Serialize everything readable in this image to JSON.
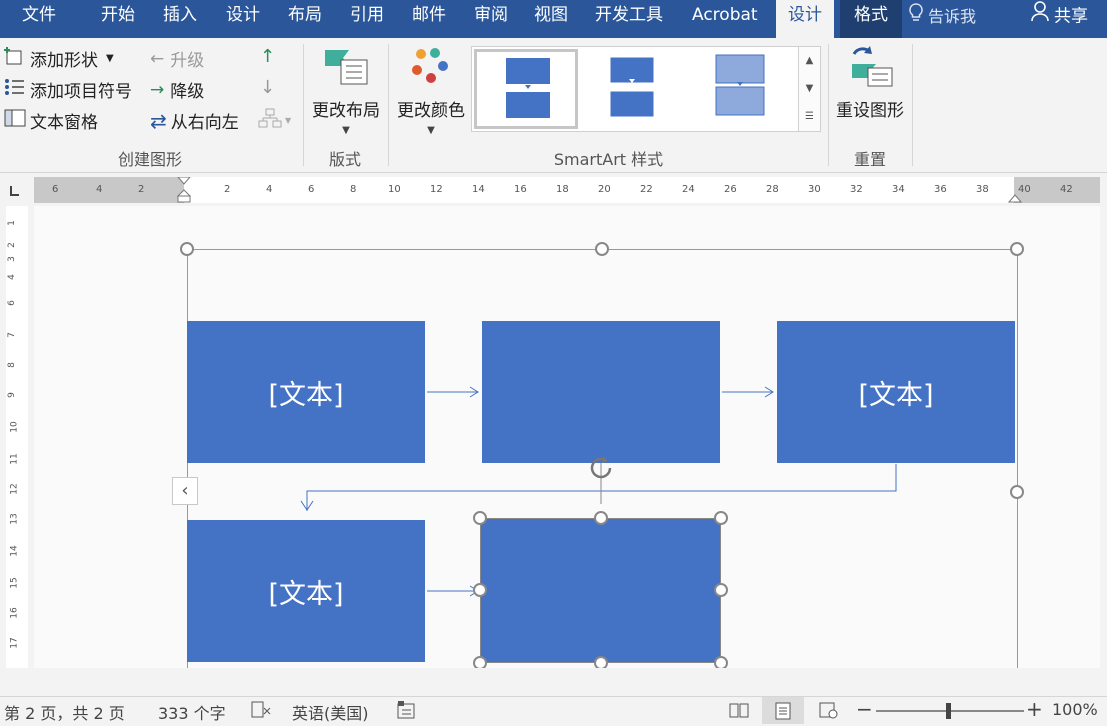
{
  "tabs": [
    {
      "label": "文件"
    },
    {
      "label": "开始"
    },
    {
      "label": "插入"
    },
    {
      "label": "设计"
    },
    {
      "label": "布局"
    },
    {
      "label": "引用"
    },
    {
      "label": "邮件"
    },
    {
      "label": "审阅"
    },
    {
      "label": "视图"
    },
    {
      "label": "开发工具"
    },
    {
      "label": "Acrobat"
    },
    {
      "label": "设计"
    },
    {
      "label": "格式"
    }
  ],
  "tell_me": "告诉我",
  "share": "共享",
  "ribbon": {
    "create": {
      "add_shape": "添加形状",
      "add_bullet": "添加项目符号",
      "text_pane": "文本窗格",
      "promote": "升级",
      "demote": "降级",
      "rtl": "从右向左",
      "group_label": "创建图形"
    },
    "layouts": {
      "change_layout": "更改布局",
      "group_label": "版式"
    },
    "styles": {
      "change_colors": "更改颜色",
      "group_label": "SmartArt 样式"
    },
    "reset": {
      "reset_graphic": "重设图形",
      "group_label": "重置"
    }
  },
  "ruler": {
    "left_ticks": [
      "6",
      "4",
      "2"
    ],
    "right_ticks": [
      "2",
      "4",
      "6",
      "8",
      "10",
      "12",
      "14",
      "16",
      "18",
      "20",
      "22",
      "24",
      "26",
      "28",
      "30",
      "32",
      "34",
      "36",
      "38",
      "40",
      "42"
    ],
    "vertical_ticks": [
      "1",
      "2",
      "3",
      "4",
      "5",
      "6",
      "7",
      "8",
      "9",
      "10",
      "11",
      "12",
      "13",
      "14",
      "15",
      "16",
      "17"
    ]
  },
  "smartart": {
    "boxes": [
      {
        "text": "[文本]"
      },
      {
        "text": ""
      },
      {
        "text": "[文本]"
      },
      {
        "text": "[文本]"
      },
      {
        "text": ""
      }
    ],
    "pane_toggle": "‹"
  },
  "status": {
    "page": "第 2 页，共 2 页",
    "words": "333 个字",
    "language": "英语(美国)",
    "zoom": "100%"
  },
  "colors": {
    "accent": "#2b579a",
    "box_fill": "#4472c4",
    "connector": "#4472c4"
  }
}
